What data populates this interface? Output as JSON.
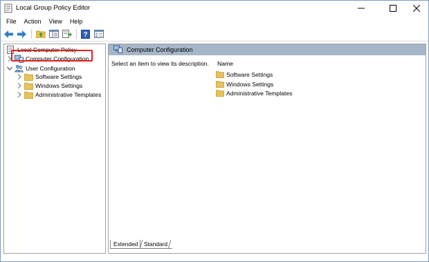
{
  "window": {
    "title": "Local Group Policy Editor",
    "icon": "policy-editor-icon"
  },
  "menu": {
    "items": [
      "File",
      "Action",
      "View",
      "Help"
    ]
  },
  "toolbar": {
    "buttons": [
      "back-icon",
      "forward-icon",
      "up-folder-icon",
      "show-hide-tree-icon",
      "export-list-icon",
      "help-icon",
      "properties-icon"
    ]
  },
  "tree": {
    "root": "Local Computer Policy",
    "items": [
      {
        "label": "Computer Configuration",
        "icon": "computer-icon",
        "expanded": false,
        "selected": true
      },
      {
        "label": "User Configuration",
        "icon": "users-icon",
        "expanded": true
      },
      {
        "label": "Software Settings",
        "icon": "folder-icon"
      },
      {
        "label": "Windows Settings",
        "icon": "folder-icon"
      },
      {
        "label": "Administrative Templates",
        "icon": "folder-icon"
      }
    ]
  },
  "details": {
    "header": "Computer Configuration",
    "description": "Select an item to view its description.",
    "column_name": "Name",
    "rows": [
      "Software Settings",
      "Windows Settings",
      "Administrative Templates"
    ]
  },
  "tabs": [
    "Extended",
    "Standard"
  ],
  "colors": {
    "header_bg": "#a5b6c9",
    "highlight": "#e2201b",
    "folder": "#e8c25b",
    "arrow": "#2e7bcf"
  }
}
